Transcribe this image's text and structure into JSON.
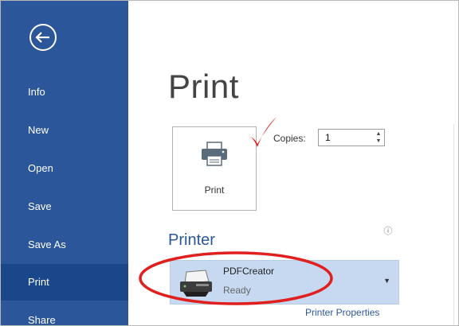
{
  "sidebar": {
    "items": [
      {
        "label": "Info"
      },
      {
        "label": "New"
      },
      {
        "label": "Open"
      },
      {
        "label": "Save"
      },
      {
        "label": "Save As"
      },
      {
        "label": "Print",
        "selected": true
      },
      {
        "label": "Share"
      }
    ],
    "back_icon": "back-arrow-icon"
  },
  "main": {
    "title": "Print",
    "print_button_label": "Print",
    "copies": {
      "label": "Copies:",
      "value": "1"
    },
    "printer_section_title": "Printer",
    "printer": {
      "name": "PDFCreator",
      "status": "Ready"
    },
    "printer_properties_link": "Printer Properties"
  },
  "annotations": {
    "checkmark_color": "#e0201f",
    "ellipse_color": "#e0201f"
  },
  "colors": {
    "sidebar_bg": "#2b579a",
    "sidebar_selected": "#19478a",
    "accent": "#2b579a",
    "dropdown_bg": "#c7d9f0"
  }
}
